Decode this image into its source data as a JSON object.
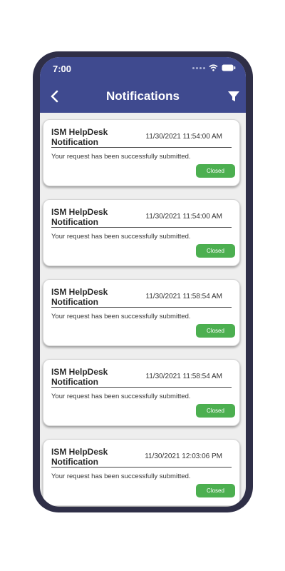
{
  "status_bar": {
    "time": "7:00"
  },
  "header": {
    "title": "Notifications"
  },
  "colors": {
    "header_bg": "#3f4a8f",
    "badge_bg": "#4caf50"
  },
  "notifications": [
    {
      "title": "ISM HelpDesk Notification",
      "datetime": "11/30/2021 11:54:00 AM",
      "message": "Your request has been successfully submitted.",
      "status": "Closed"
    },
    {
      "title": "ISM HelpDesk Notification",
      "datetime": "11/30/2021 11:54:00 AM",
      "message": "Your request has been successfully submitted.",
      "status": "Closed"
    },
    {
      "title": "ISM HelpDesk Notification",
      "datetime": "11/30/2021 11:58:54 AM",
      "message": "Your request has been successfully submitted.",
      "status": "Closed"
    },
    {
      "title": "ISM HelpDesk Notification",
      "datetime": "11/30/2021 11:58:54 AM",
      "message": "Your request has been successfully submitted.",
      "status": "Closed"
    },
    {
      "title": "ISM HelpDesk Notification",
      "datetime": "11/30/2021 12:03:06 PM",
      "message": "Your request has been successfully submitted.",
      "status": "Closed"
    }
  ]
}
